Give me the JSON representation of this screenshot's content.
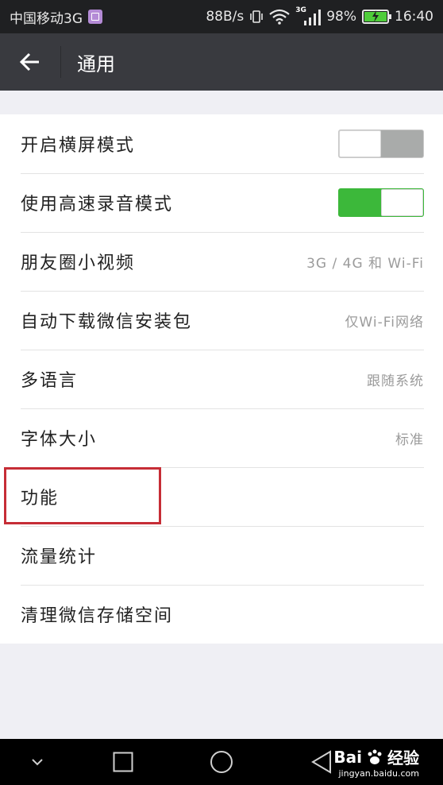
{
  "status_bar": {
    "carrier": "中国移动3G",
    "speed": "88B/s",
    "network_badge": "3G",
    "battery": "98%",
    "time": "16:40"
  },
  "header": {
    "title": "通用"
  },
  "settings": [
    {
      "label": "开启横屏模式",
      "type": "toggle",
      "state": "off"
    },
    {
      "label": "使用高速录音模式",
      "type": "toggle",
      "state": "on"
    },
    {
      "label": "朋友圈小视频",
      "type": "value",
      "value": "3G / 4G 和 Wi-Fi"
    },
    {
      "label": "自动下载微信安装包",
      "type": "value",
      "value": "仅Wi-Fi网络"
    },
    {
      "label": "多语言",
      "type": "value",
      "value": "跟随系统"
    },
    {
      "label": "字体大小",
      "type": "value",
      "value": "标准"
    },
    {
      "label": "功能",
      "type": "link"
    },
    {
      "label": "流量统计",
      "type": "link"
    },
    {
      "label": "清理微信存储空间",
      "type": "link"
    }
  ],
  "watermark": {
    "brand_left": "Bai",
    "brand_right": "经验",
    "url": "jingyan.baidu.com"
  },
  "colors": {
    "title_bar": "#393a3f",
    "toggle_on": "#3cb83a",
    "highlight": "#c62d36"
  },
  "icons": {
    "back": "arrow-left-icon",
    "nav_down": "chevron-down-icon",
    "nav_recent": "square-icon",
    "nav_home": "circle-icon",
    "nav_back": "triangle-back-icon"
  }
}
